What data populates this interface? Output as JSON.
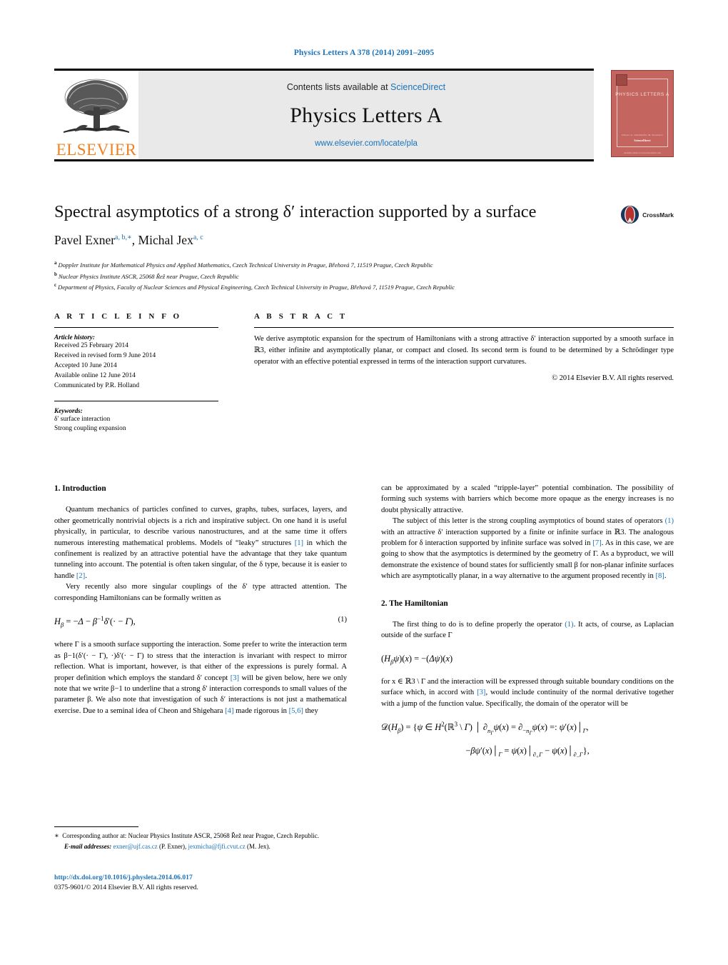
{
  "running_head": "Physics Letters A 378 (2014) 2091–2095",
  "masthead": {
    "contents_prefix": "Contents lists available at ",
    "sciencedirect": "ScienceDirect",
    "journal_title": "Physics Letters A",
    "journal_url": "www.elsevier.com/locate/pla",
    "publisher_wordmark": "ELSEVIER",
    "cover": {
      "title": "PHYSICS LETTERS A",
      "foot1": "Editors: G. Oberndorfer, M. Sloojevice",
      "foot2": "ScienceDirect",
      "foot3": "Available online at www.sciencedirect.com"
    }
  },
  "article": {
    "title": "Spectral asymptotics of a strong δ′ interaction supported by a surface",
    "authors_part1": "Pavel Exner",
    "authors_marks1": "a, b,∗",
    "authors_part2": ", Michal Jex",
    "authors_marks2": "a, c",
    "crossmark_label": "CrossMark",
    "affiliations": [
      {
        "letter": "a",
        "text": "Doppler Institute for Mathematical Physics and Applied Mathematics, Czech Technical University in Prague, Břehová 7, 11519 Prague, Czech Republic"
      },
      {
        "letter": "b",
        "text": "Nuclear Physics Institute ASCR, 25068 Řež near Prague, Czech Republic"
      },
      {
        "letter": "c",
        "text": "Department of Physics, Faculty of Nuclear Sciences and Physical Engineering, Czech Technical University in Prague, Břehová 7, 11519 Prague, Czech Republic"
      }
    ]
  },
  "info": {
    "heading": "A R T I C L E   I N F O",
    "history_label": "Article history:",
    "history": [
      "Received 25 February 2014",
      "Received in revised form 9 June 2014",
      "Accepted 10 June 2014",
      "Available online 12 June 2014",
      "Communicated by P.R. Holland"
    ],
    "keywords_label": "Keywords:",
    "keywords": [
      "δ′ surface interaction",
      "Strong coupling expansion"
    ]
  },
  "abstract": {
    "heading": "A B S T R A C T",
    "text": "We derive asymptotic expansion for the spectrum of Hamiltonians with a strong attractive δ′ interaction supported by a smooth surface in ℝ3, either infinite and asymptotically planar, or compact and closed. Its second term is found to be determined by a Schrödinger type operator with an effective potential expressed in terms of the interaction support curvatures.",
    "copyright": "© 2014 Elsevier B.V. All rights reserved."
  },
  "body": {
    "section1_title": "1. Introduction",
    "p1_a": "Quantum mechanics of particles confined to curves, graphs, tubes, surfaces, layers, and other geometrically nontrivial objects is a rich and inspirative subject. On one hand it is useful physically, in particular, to describe various nanostructures, and at the same time it offers numerous interesting mathematical problems. Models of “leaky” structures ",
    "p1_ref1": "[1]",
    "p1_b": " in which the confinement is realized by an attractive potential have the advantage that they take quantum tunneling into account. The potential is often taken singular, of the δ type, because it is easier to handle ",
    "p1_ref2": "[2]",
    "p1_c": ".",
    "p2_a": "Very recently also more singular couplings of the δ′ type attracted attention. The corresponding Hamiltonians can be formally written as",
    "eq1_num": "(1)",
    "p3_a": "where Γ is a smooth surface supporting the interaction. Some prefer to write the interaction term as β−1(δ′(· − Γ), ·)δ′(· − Γ) to stress that the interaction is invariant with respect to mirror reflection. What is important, however, is that either of the expressions is purely formal. A proper definition which employs the standard δ′ concept ",
    "p3_ref3": "[3]",
    "p3_b": " will be given below, here we only note that we write β−1 to underline that a strong δ′ interaction corresponds to small values of the parameter β. We also note that investigation of such δ′ interactions is not just a mathematical exercise. Due to a seminal idea of Cheon and Shigehara ",
    "p3_ref4": "[4]",
    "p3_c": " made rigorous in ",
    "p3_ref56": "[5,6]",
    "p3_d": " they",
    "r_p1_a": "can be approximated by a scaled “tripple-layer” potential combination. The possibility of forming such systems with barriers which become more opaque as the energy increases is no doubt physically attractive.",
    "r_p2_a": "The subject of this letter is the strong coupling asymptotics of bound states of operators ",
    "r_p2_ref1": "(1)",
    "r_p2_b": " with an attractive δ′ interaction supported by a finite or infinite surface in ℝ3. The analogous problem for δ interaction supported by infinite surface was solved in ",
    "r_p2_ref7": "[7]",
    "r_p2_c": ". As in this case, we are going to show that the asymptotics is determined by the geometry of Γ. As a byproduct, we will demonstrate the existence of bound states for sufficiently small β for non-planar infinite surfaces which are asymptotically planar, in a way alternative to the argument proposed recently in ",
    "r_p2_ref8": "[8]",
    "r_p2_d": ".",
    "section2_title": "2. The Hamiltonian",
    "r_p3_a": "The first thing to do is to define properly the operator ",
    "r_p3_ref1": "(1)",
    "r_p3_b": ". It acts, of course, as Laplacian outside of the surface Γ",
    "r_p4_a": "for x ∈ ℝ3 \\ Γ and the interaction will be expressed through suitable boundary conditions on the surface which, in accord with ",
    "r_p4_ref3": "[3]",
    "r_p4_b": ", would include continuity of the normal derivative together with a jump of the function value. Specifically, the domain of the operator will be"
  },
  "footnote": {
    "star": "∗",
    "line1": "Corresponding author at: Nuclear Physics Institute ASCR, 25068 Řež near Prague, Czech Republic.",
    "emails_label": "E-mail addresses:",
    "email1": "exner@ujf.cas.cz",
    "email1_who": "(P. Exner),",
    "email2": "jexmicha@fjfi.cvut.cz",
    "email2_who": "(M. Jex)."
  },
  "footer": {
    "doi": "http://dx.doi.org/10.1016/j.physleta.2014.06.017",
    "issn_line": "0375-9601/© 2014 Elsevier B.V. All rights reserved."
  },
  "colors": {
    "link": "#1b72b8",
    "elsevier_orange": "#f08122",
    "cover_red": "#c4655f"
  }
}
